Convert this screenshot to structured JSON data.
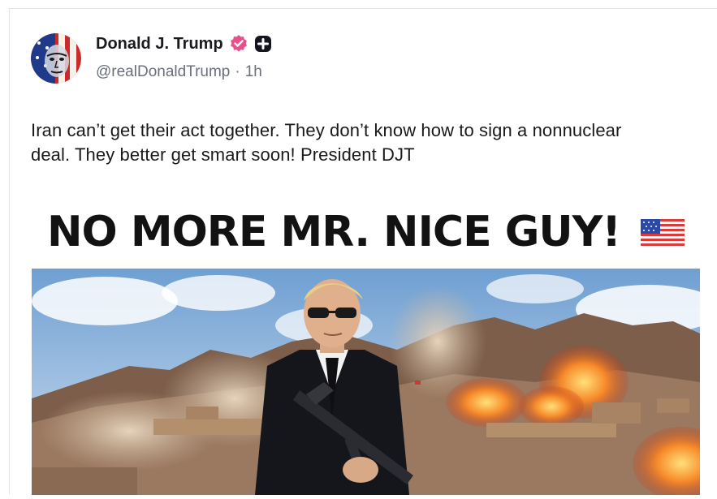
{
  "post": {
    "author": {
      "name": "Donald J. Trump",
      "handle": "@realDonaldTrump",
      "separator": "·",
      "time": "1h",
      "badges": [
        "verified-badge-icon",
        "plus-badge-icon"
      ]
    },
    "text": "Iran can’t get their act together. They don’t know how to sign a nonnuclear deal. They better get smart soon! President DJT",
    "media": {
      "headline": "NO MORE MR. NICE GUY!",
      "flag": "us-flag-emoji"
    }
  },
  "colors": {
    "verified_badge": "#e8508b",
    "plus_badge": "#15151f",
    "meta_text": "#6b6f7a",
    "rule": "#e4e4e8"
  }
}
